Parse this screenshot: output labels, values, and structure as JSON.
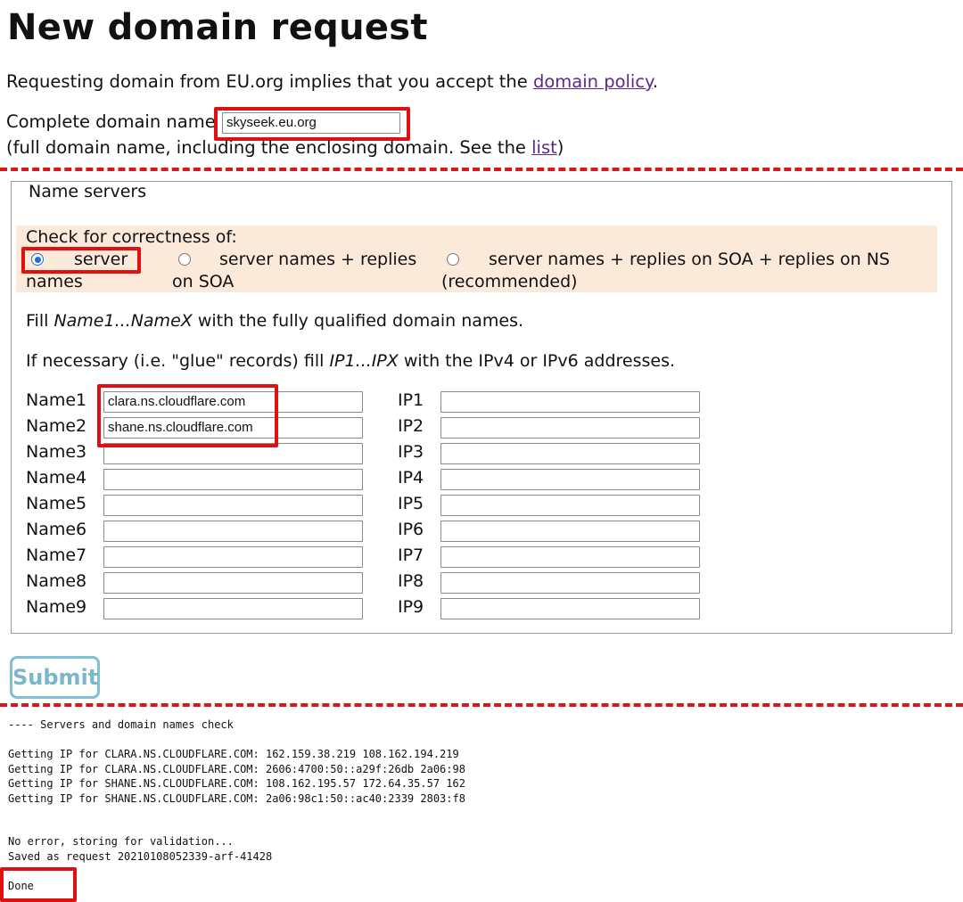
{
  "page": {
    "title": "New domain request",
    "intro_text": "Requesting domain from EU.org implies that you accept the ",
    "intro_link": "domain policy",
    "intro_end": ".",
    "domain_label": "Complete domain name",
    "domain_value": "skyseek.eu.org",
    "domain_hint_text": "(full domain name, including the enclosing domain. See the ",
    "domain_hint_link": "list",
    "domain_hint_end": ")"
  },
  "nameservers": {
    "legend": "Name servers",
    "check_label": "Check for correctness of:",
    "options": [
      {
        "line1": "server",
        "line2": "names",
        "selected": true
      },
      {
        "line1": "server names + replies",
        "line2": "on SOA",
        "selected": false
      },
      {
        "line1": "server names + replies on SOA + replies on NS",
        "line2": "(recommended)",
        "selected": false
      }
    ],
    "fill_text_a": "Fill ",
    "fill_text_em": "Name1...NameX",
    "fill_text_b": " with the fully qualified domain names.",
    "glue_text_a": "If necessary (i.e. \"glue\" records) fill ",
    "glue_text_em": "IP1...IPX",
    "glue_text_b": " with the IPv4 or IPv6 addresses.",
    "rows": [
      {
        "name_label": "Name1",
        "name_value": "clara.ns.cloudflare.com",
        "ip_label": "IP1",
        "ip_value": ""
      },
      {
        "name_label": "Name2",
        "name_value": "shane.ns.cloudflare.com",
        "ip_label": "IP2",
        "ip_value": ""
      },
      {
        "name_label": "Name3",
        "name_value": "",
        "ip_label": "IP3",
        "ip_value": ""
      },
      {
        "name_label": "Name4",
        "name_value": "",
        "ip_label": "IP4",
        "ip_value": ""
      },
      {
        "name_label": "Name5",
        "name_value": "",
        "ip_label": "IP5",
        "ip_value": ""
      },
      {
        "name_label": "Name6",
        "name_value": "",
        "ip_label": "IP6",
        "ip_value": ""
      },
      {
        "name_label": "Name7",
        "name_value": "",
        "ip_label": "IP7",
        "ip_value": ""
      },
      {
        "name_label": "Name8",
        "name_value": "",
        "ip_label": "IP8",
        "ip_value": ""
      },
      {
        "name_label": "Name9",
        "name_value": "",
        "ip_label": "IP9",
        "ip_value": ""
      }
    ]
  },
  "submit_label": "Submit",
  "output": {
    "header": "---- Servers and domain names check",
    "ip_lines": [
      "Getting IP for CLARA.NS.CLOUDFLARE.COM: 162.159.38.219 108.162.194.219",
      "Getting IP for CLARA.NS.CLOUDFLARE.COM: 2606:4700:50::a29f:26db 2a06:98",
      "Getting IP for SHANE.NS.CLOUDFLARE.COM: 108.162.195.57 172.64.35.57 162",
      "Getting IP for SHANE.NS.CLOUDFLARE.COM: 2a06:98c1:50::ac40:2339 2803:f8"
    ],
    "status_lines": [
      "No error, storing for validation...",
      "Saved as request 20210108052339-arf-41428"
    ],
    "done": "Done"
  },
  "colors": {
    "annotation_red": "#e01010",
    "option_bg": "#fbe9da",
    "link": "#5a2a8a",
    "radio_selected": "#1f6fd0",
    "submit_border": "#7ec0d6"
  }
}
